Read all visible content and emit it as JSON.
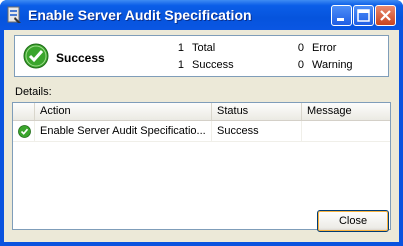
{
  "window": {
    "title": "Enable Server Audit Specification",
    "icon": "sql-server-icon",
    "controls": [
      "minimize",
      "maximize",
      "close"
    ]
  },
  "summary": {
    "icon": "success-check-icon",
    "status": "Success",
    "counts": {
      "total_num": "1",
      "total_label": "Total",
      "success_num": "1",
      "success_label": "Success",
      "error_num": "0",
      "error_label": "Error",
      "warning_num": "0",
      "warning_label": "Warning"
    }
  },
  "details": {
    "label": "Details:",
    "columns": [
      "Action",
      "Status",
      "Message"
    ],
    "rows": [
      {
        "icon": "success-check-icon",
        "action": "Enable Server Audit Specificatio...",
        "status": "Success",
        "message": ""
      }
    ]
  },
  "footer": {
    "close_label": "Close"
  },
  "colors": {
    "titlebar": "#0654dd",
    "client": "#ece9d8",
    "success_green": "#3aa52c"
  }
}
